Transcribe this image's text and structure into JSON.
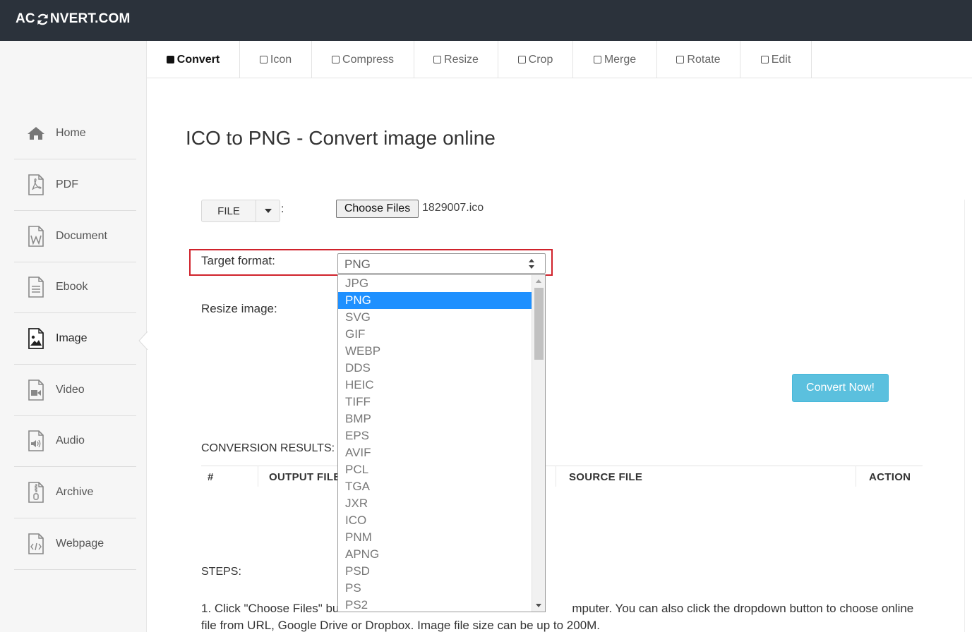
{
  "header": {
    "logo_part1": "AC",
    "logo_part2": "NVERT.COM"
  },
  "sidebar": {
    "items": [
      {
        "label": "Home",
        "icon": "home-icon"
      },
      {
        "label": "PDF",
        "icon": "pdf-icon"
      },
      {
        "label": "Document",
        "icon": "document-icon"
      },
      {
        "label": "Ebook",
        "icon": "ebook-icon"
      },
      {
        "label": "Image",
        "icon": "image-icon",
        "active": true
      },
      {
        "label": "Video",
        "icon": "video-icon"
      },
      {
        "label": "Audio",
        "icon": "audio-icon"
      },
      {
        "label": "Archive",
        "icon": "archive-icon"
      },
      {
        "label": "Webpage",
        "icon": "webpage-icon"
      }
    ]
  },
  "tabs": [
    {
      "label": "Convert",
      "active": true
    },
    {
      "label": "Icon"
    },
    {
      "label": "Compress"
    },
    {
      "label": "Resize"
    },
    {
      "label": "Crop"
    },
    {
      "label": "Merge"
    },
    {
      "label": "Rotate"
    },
    {
      "label": "Edit"
    }
  ],
  "main": {
    "title": "ICO to PNG - Convert image online",
    "file_button": "FILE",
    "colon": ":",
    "choose_files": "Choose Files",
    "file_name": "1829007.ico",
    "target_format_label": "Target format:",
    "target_format_value": "PNG",
    "resize_label": "Resize image:",
    "convert_button": "Convert Now!",
    "results_label": "CONVERSION RESULTS:",
    "table_headers": {
      "num": "#",
      "output": "OUTPUT FILE",
      "source": "SOURCE FILE",
      "action": "ACTION"
    },
    "steps_label": "STEPS:",
    "steps_text_before": "1. Click \"Choose Files\" bu",
    "steps_text_after": "mputer. You can also click the dropdown button to choose online",
    "steps_text_line2": "file from URL, Google Drive or Dropbox. Image file size can be up to 200M."
  },
  "dropdown": {
    "options": [
      "JPG",
      "PNG",
      "SVG",
      "GIF",
      "WEBP",
      "DDS",
      "HEIC",
      "TIFF",
      "BMP",
      "EPS",
      "AVIF",
      "PCL",
      "TGA",
      "JXR",
      "ICO",
      "PNM",
      "APNG",
      "PSD",
      "PS",
      "PS2"
    ],
    "selected": "PNG"
  },
  "colors": {
    "header_bg": "#2b323b",
    "highlight_border": "#d0222b",
    "selected_option": "#1e90ff",
    "convert_button": "#5bc0de"
  }
}
